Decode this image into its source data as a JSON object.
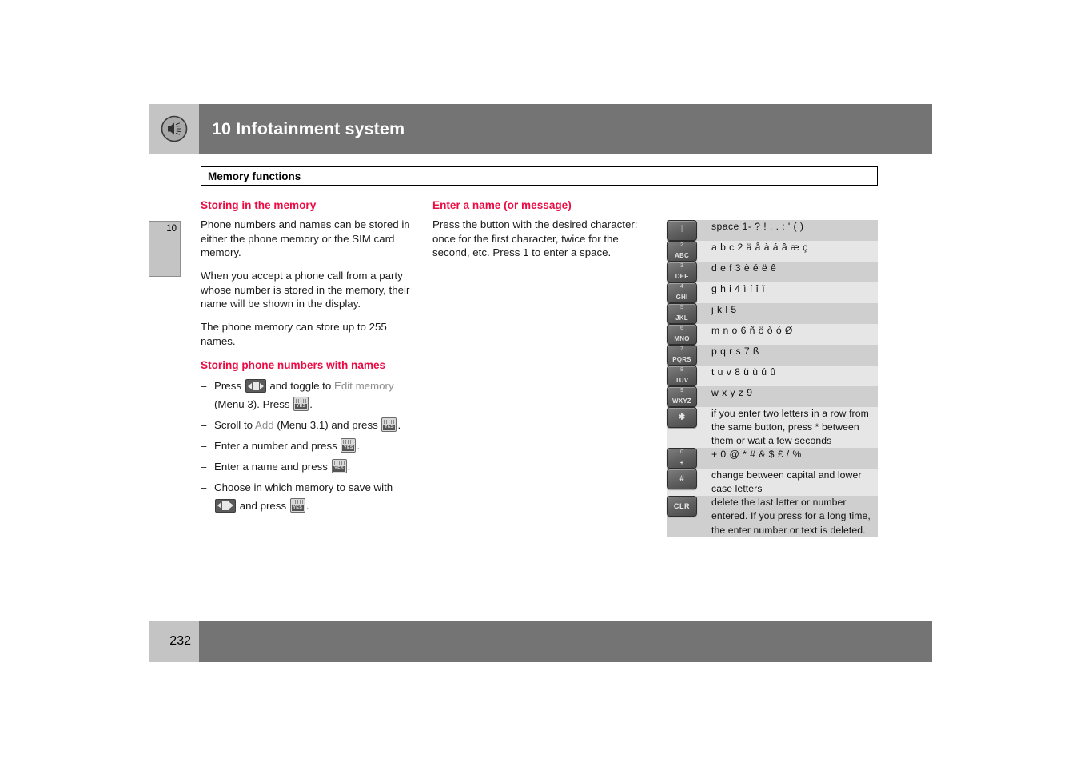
{
  "header": {
    "title": "10 Infotainment system",
    "icon": "speaker-icon",
    "bar_color": "#747474",
    "tab_color": "#c4c4c4"
  },
  "section": {
    "title": "Memory functions"
  },
  "chapter_tab": {
    "number": "10"
  },
  "accent_color": "#ec0b43",
  "columns": {
    "left": {
      "heading1": "Storing in the memory",
      "paragraphs": [
        "Phone numbers and names can be stored in either the phone memory or the SIM card memory.",
        "When you accept a phone call from a party whose number is stored in the memory, their name will be shown in the display.",
        "The phone memory can store up to 255 names."
      ],
      "heading2": "Storing phone numbers with names",
      "steps": [
        {
          "parts": [
            {
              "type": "text",
              "value": "Press "
            },
            {
              "type": "key",
              "value": "toggle-key"
            },
            {
              "type": "text",
              "value": " and toggle to "
            },
            {
              "type": "highlight",
              "value": "Edit memory"
            },
            {
              "type": "text",
              "value": " (Menu 3). Press "
            },
            {
              "type": "key",
              "value": "yes-key"
            },
            {
              "type": "text",
              "value": "."
            }
          ]
        },
        {
          "parts": [
            {
              "type": "text",
              "value": "Scroll to "
            },
            {
              "type": "highlight",
              "value": "Add"
            },
            {
              "type": "text",
              "value": " (Menu 3.1) and press "
            },
            {
              "type": "key",
              "value": "yes-key"
            },
            {
              "type": "text",
              "value": "."
            }
          ]
        },
        {
          "parts": [
            {
              "type": "text",
              "value": "Enter a number and press "
            },
            {
              "type": "key",
              "value": "yes-key"
            },
            {
              "type": "text",
              "value": "."
            }
          ]
        },
        {
          "parts": [
            {
              "type": "text",
              "value": "Enter a name and press "
            },
            {
              "type": "key",
              "value": "yes-key"
            },
            {
              "type": "text",
              "value": "."
            }
          ]
        },
        {
          "parts": [
            {
              "type": "text",
              "value": "Choose in which memory to save with "
            },
            {
              "type": "key",
              "value": "toggle-key"
            },
            {
              "type": "text",
              "value": " and press "
            },
            {
              "type": "key",
              "value": "yes-key"
            },
            {
              "type": "text",
              "value": "."
            }
          ]
        }
      ],
      "dash": "–"
    },
    "middle": {
      "heading1": "Enter a name (or message)",
      "paragraphs": [
        "Press the button with the desired character: once for the first character, twice for the second, etc. Press 1 to enter a space."
      ]
    }
  },
  "keypad_table": {
    "rows": [
      {
        "key": {
          "name": "key-1",
          "num": "1",
          "lets": "",
          "style": "blank"
        },
        "description": "space 1- ? ! , . : ' ( )"
      },
      {
        "key": {
          "name": "key-2",
          "num": "2",
          "lets": "ABC",
          "style": "normal"
        },
        "description": "a b c 2 ä å à á â æ ç"
      },
      {
        "key": {
          "name": "key-3",
          "num": "3",
          "lets": "DEF",
          "style": "normal"
        },
        "description": "d e f 3 è é ë ê"
      },
      {
        "key": {
          "name": "key-4",
          "num": "4",
          "lets": "GHI",
          "style": "normal"
        },
        "description": "g h i 4 ì í î ï"
      },
      {
        "key": {
          "name": "key-5",
          "num": "5",
          "lets": "JKL",
          "style": "normal"
        },
        "description": "j k l 5"
      },
      {
        "key": {
          "name": "key-6",
          "num": "6",
          "lets": "MNO",
          "style": "normal"
        },
        "description": "m n o 6 ñ ö ò ó Ø"
      },
      {
        "key": {
          "name": "key-7",
          "num": "7",
          "lets": "PQRS",
          "style": "normal"
        },
        "description": "p q r s 7 ß"
      },
      {
        "key": {
          "name": "key-8",
          "num": "8",
          "lets": "TUV",
          "style": "normal"
        },
        "description": "t u v 8 ü ù ú û"
      },
      {
        "key": {
          "name": "key-9",
          "num": "9",
          "lets": "WXYZ",
          "style": "normal"
        },
        "description": "w x y z 9"
      },
      {
        "key": {
          "name": "key-star",
          "num": "",
          "lets": "",
          "big": "✱",
          "style": "big"
        },
        "description": "if you enter two letters in a row from the same button, press * between them or wait a few seconds"
      },
      {
        "key": {
          "name": "key-0",
          "num": "0",
          "lets": "+",
          "style": "normal"
        },
        "description": "+ 0 @ * # & $ £ / %"
      },
      {
        "key": {
          "name": "key-hash",
          "num": "",
          "lets": "",
          "big": "#",
          "style": "big"
        },
        "description": "change between capital and lower case letters"
      },
      {
        "key": {
          "name": "key-clr",
          "num": "",
          "lets": "",
          "clr": "CLR",
          "style": "clr"
        },
        "description": "delete the last letter or number entered. If you press for a long time, the enter number or text is deleted."
      }
    ],
    "row_color_odd": "#cfcfcf",
    "row_color_even": "#e6e6e6"
  },
  "footer": {
    "page_number": "232",
    "bar_color": "#747474",
    "box_color": "#c4c4c4"
  }
}
